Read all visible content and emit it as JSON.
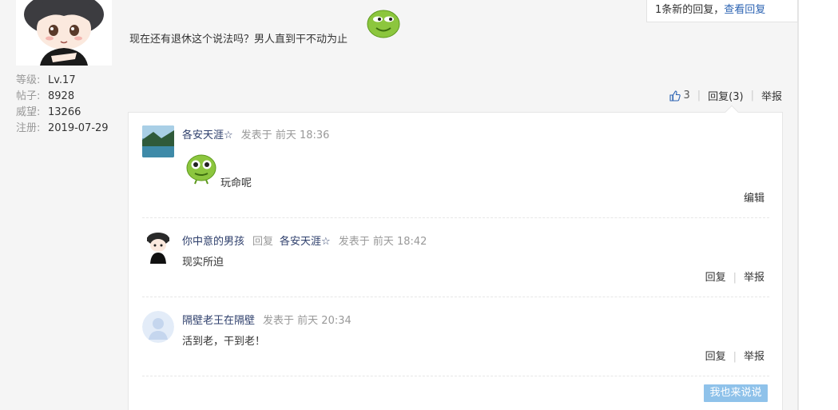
{
  "notice": {
    "prefix": "1条新的回复，",
    "link": "查看回复"
  },
  "user": {
    "stats": [
      {
        "key": "等级:",
        "value": "Lv.17"
      },
      {
        "key": "帖子:",
        "value": "8928"
      },
      {
        "key": "威望:",
        "value": "13266"
      },
      {
        "key": "注册:",
        "value": "2019-07-29"
      }
    ]
  },
  "post": {
    "text": "现在还有退休这个说法吗？男人直到干不动为止",
    "like_count": "3",
    "reply_label": "回复(3)",
    "report_label": "举报"
  },
  "comments": [
    {
      "name": "各安天涯☆",
      "posted_label": "发表于",
      "time": "前天 18:36",
      "body": "玩命呢",
      "action": "编辑"
    },
    {
      "name": "你中意的男孩",
      "reply_word": "回复",
      "target": "各安天涯☆",
      "posted_label": "发表于",
      "time": "前天 18:42",
      "body": "现实所迫",
      "reply_label": "回复",
      "report_label": "举报"
    },
    {
      "name": "隔壁老王在隔壁",
      "posted_label": "发表于",
      "time": "前天 20:34",
      "body": "活到老，干到老！",
      "reply_label": "回复",
      "report_label": "举报"
    }
  ],
  "reply_button": "我也来说说",
  "colors": {
    "link": "#2d64b3",
    "name": "#2d3e6b",
    "button": "#8fc2ea",
    "emoji": "#8cc63e"
  }
}
